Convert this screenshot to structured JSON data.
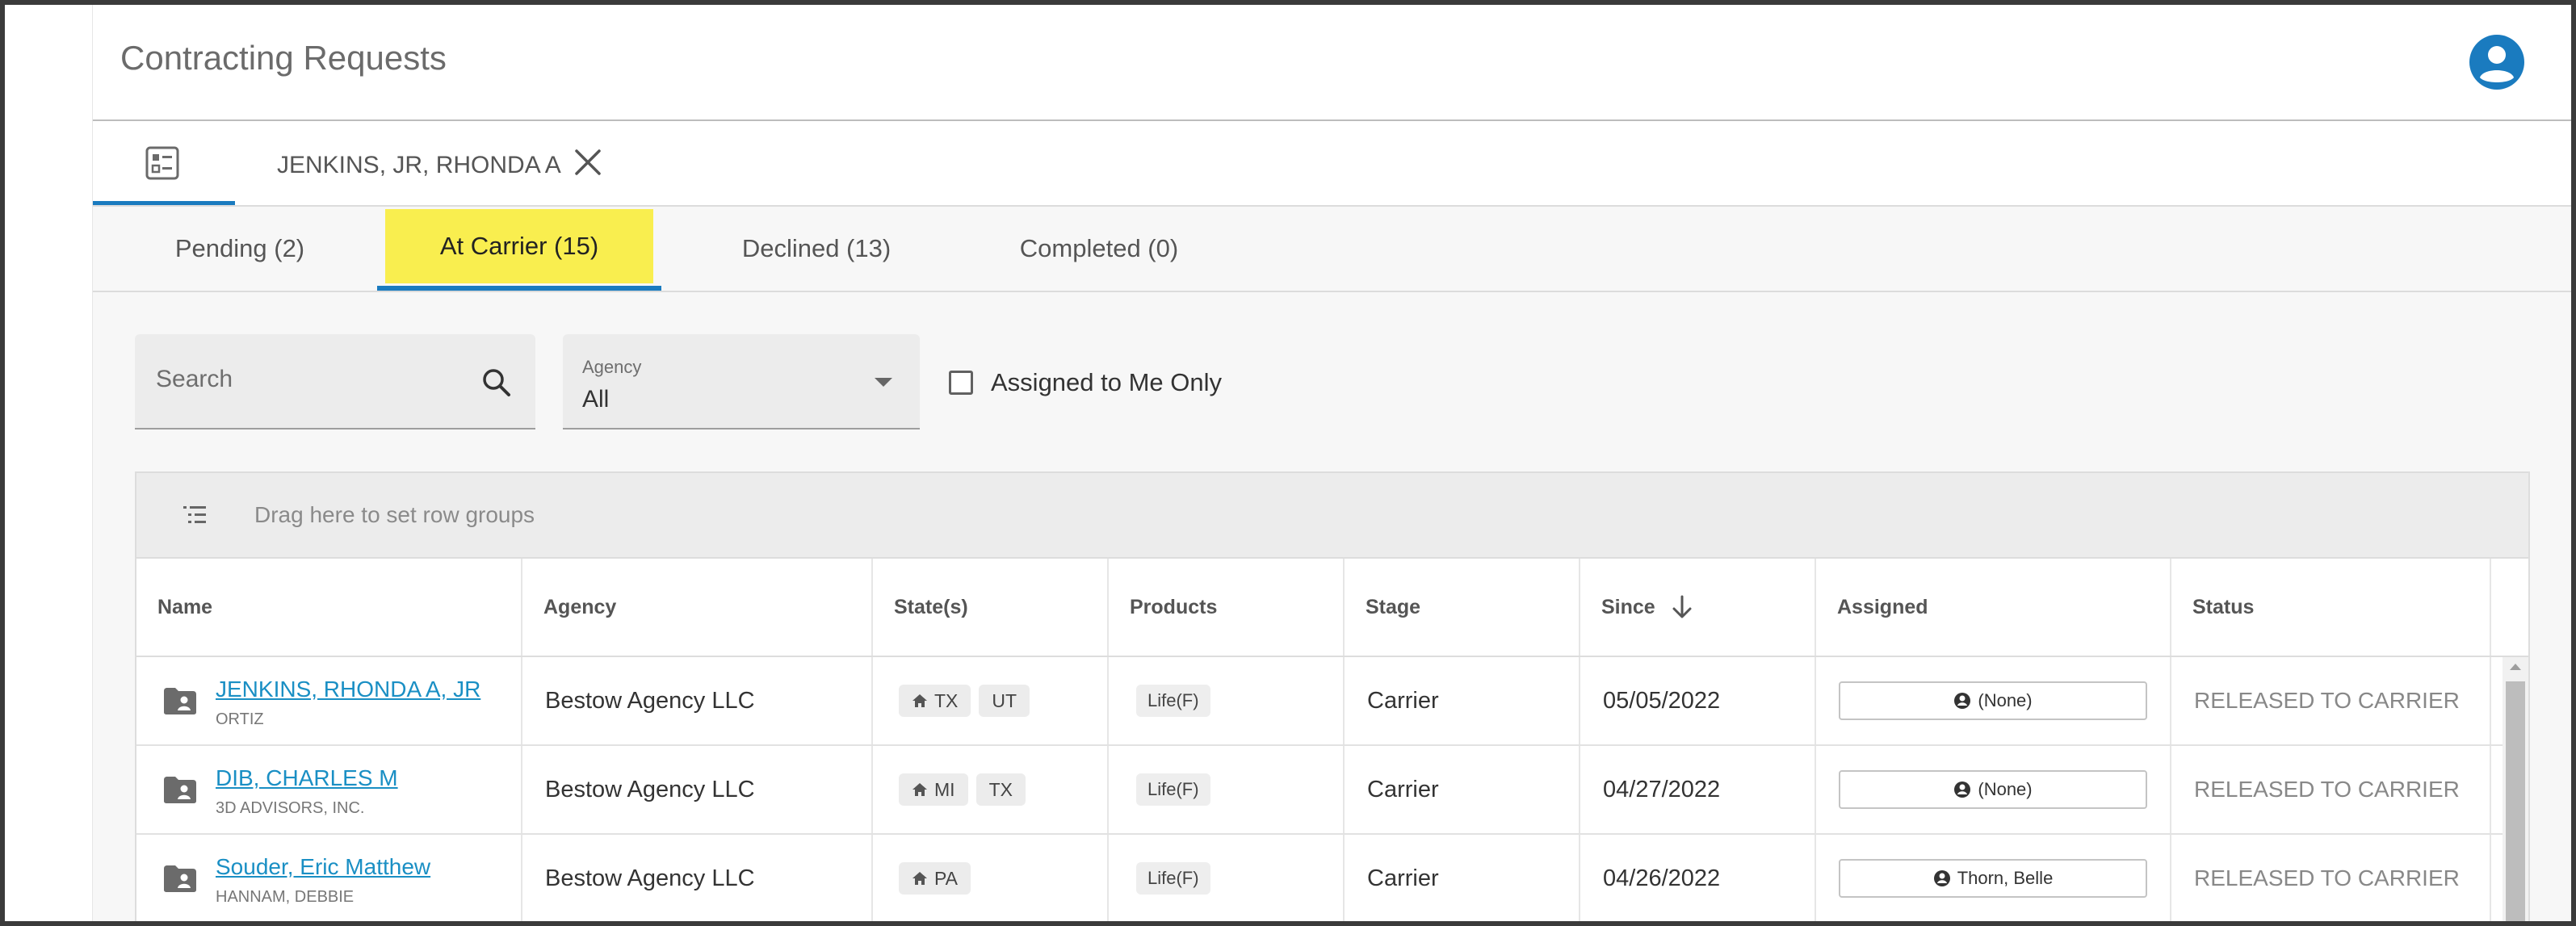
{
  "app": {
    "title": "Contracting Requests"
  },
  "record_tab": {
    "label": "JENKINS, JR, RHONDA A"
  },
  "status_tabs": [
    {
      "label": "Pending (2)"
    },
    {
      "label": "At Carrier (15)"
    },
    {
      "label": "Declined (13)"
    },
    {
      "label": "Completed (0)"
    }
  ],
  "filters": {
    "search_placeholder": "Search",
    "agency_label": "Agency",
    "agency_value": "All",
    "assigned_to_me_label": "Assigned to Me Only"
  },
  "grid": {
    "group_bar_text": "Drag here to set row groups",
    "columns": [
      "Name",
      "Agency",
      "State(s)",
      "Products",
      "Stage",
      "Since",
      "Assigned",
      "Status"
    ],
    "rows": [
      {
        "name": "JENKINS, RHONDA A, JR",
        "sub": "ORTIZ",
        "agency": "Bestow Agency LLC",
        "home_state": "TX",
        "other_state": "UT",
        "product": "Life(F)",
        "stage": "Carrier",
        "since": "05/05/2022",
        "assigned": "(None)",
        "status": "RELEASED TO CARRIER"
      },
      {
        "name": "DIB, CHARLES M",
        "sub": "3D ADVISORS, INC.",
        "agency": "Bestow Agency LLC",
        "home_state": "MI",
        "other_state": "TX",
        "product": "Life(F)",
        "stage": "Carrier",
        "since": "04/27/2022",
        "assigned": "(None)",
        "status": "RELEASED TO CARRIER"
      },
      {
        "name": "Souder, Eric Matthew",
        "sub": "HANNAM, DEBBIE",
        "agency": "Bestow Agency LLC",
        "home_state": "PA",
        "other_state": "",
        "product": "Life(F)",
        "stage": "Carrier",
        "since": "04/26/2022",
        "assigned": "Thorn, Belle",
        "status": "RELEASED TO CARRIER"
      }
    ]
  },
  "colors": {
    "accent": "#1a7bbf",
    "highlight": "#f9ee4f",
    "link": "#1a8fc4"
  }
}
